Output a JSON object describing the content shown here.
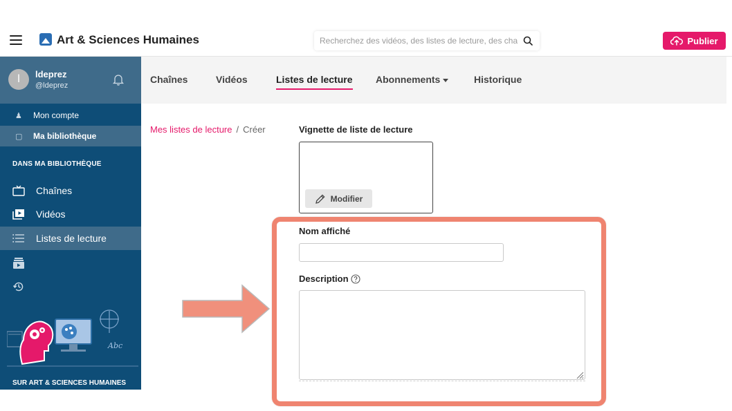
{
  "header": {
    "brand": "Art & Sciences Humaines",
    "search_placeholder": "Recherchez des vidéos, des listes de lecture, des chaînes",
    "publish_label": "Publier"
  },
  "user": {
    "initial": "l",
    "name": "ldeprez",
    "handle": "@ldeprez"
  },
  "sidebar": {
    "account_label": "Mon compte",
    "library_label": "Ma bibliothèque",
    "section_library": "DANS MA BIBLIOTHÈQUE",
    "items": [
      {
        "label": "Chaînes"
      },
      {
        "label": "Vidéos"
      },
      {
        "label": "Listes de lecture"
      }
    ],
    "footer_section": "SUR ART & SCIENCES HUMAINES"
  },
  "tabs": [
    {
      "label": "Chaînes"
    },
    {
      "label": "Vidéos"
    },
    {
      "label": "Listes de lecture"
    },
    {
      "label": "Abonnements"
    },
    {
      "label": "Historique"
    }
  ],
  "breadcrumb": {
    "parent": "Mes listes de lecture",
    "separator": "/",
    "current": "Créer"
  },
  "form": {
    "thumbnail_label": "Vignette de liste de lecture",
    "modify_label": "Modifier",
    "name_label": "Nom affiché",
    "name_value": "",
    "description_label": "Description",
    "description_value": ""
  },
  "colors": {
    "accent": "#e5196a",
    "sidebar": "#0e4d77",
    "sidebar_active": "#3f6b8a",
    "highlight": "#ef8470"
  }
}
